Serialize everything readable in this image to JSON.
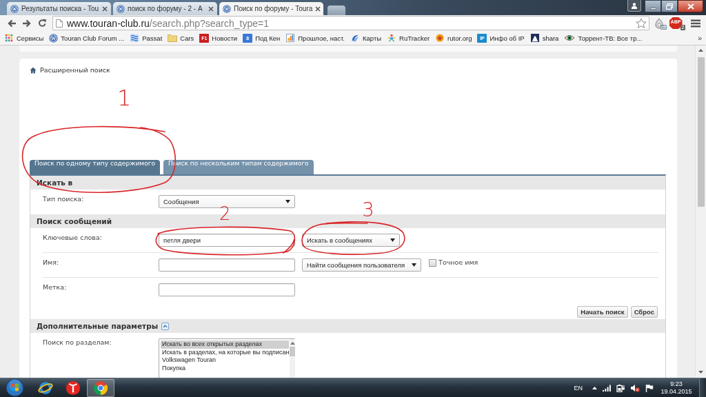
{
  "browser": {
    "tabs": [
      {
        "title": "Результаты поиска - Tou",
        "selected": false
      },
      {
        "title": "поиск по форуму - 2 - А",
        "selected": false
      },
      {
        "title": "Поиск по форуму - Toura",
        "selected": true
      }
    ],
    "address_bar": {
      "domain": "www.touran-club.ru",
      "path": "/search.php?search_type=1"
    },
    "extensions": [
      {
        "kind": "toggle",
        "label": "off"
      },
      {
        "kind": "blocker",
        "label": "ABP",
        "count": "2"
      }
    ],
    "bookmarks": [
      {
        "kind": "apps",
        "label": "Сервисы"
      },
      {
        "kind": "round-logo",
        "label": "Touran Club Forum ..."
      },
      {
        "kind": "stripes",
        "label": "Passat"
      },
      {
        "kind": "folder",
        "label": "Cars"
      },
      {
        "kind": "tile",
        "label": "Новости",
        "icon_text": "F1",
        "color": "#cc1f1f"
      },
      {
        "kind": "tile",
        "label": "Под Кен",
        "icon_text": "8",
        "color": "#3a78d8"
      },
      {
        "kind": "chart",
        "label": "Прошлое, наст."
      },
      {
        "kind": "swoosh",
        "label": "Карты"
      },
      {
        "kind": "figure",
        "label": "RuTracker"
      },
      {
        "kind": "star",
        "label": "rutor.org"
      },
      {
        "kind": "tile",
        "label": "Инфо об IP",
        "icon_text": "IP",
        "color": "#1a8ccc"
      },
      {
        "kind": "road",
        "label": "shara"
      },
      {
        "kind": "eye",
        "label": "Торрент-ТВ: Все тр..."
      }
    ],
    "bookmarks_overflow": "»"
  },
  "page": {
    "breadcrumb": "Расширенный поиск",
    "search_tabs": [
      {
        "label": "Поиск по одному типу содержимого",
        "selected": true
      },
      {
        "label": "Поиск по нескольким типам содержимого",
        "selected": false
      }
    ],
    "sections": [
      {
        "title": "Искать в",
        "collapsible": false,
        "rows": [
          {
            "label": "Тип поиска:",
            "fields": [
              {
                "kind": "select",
                "value": "Сообщения"
              }
            ]
          }
        ]
      },
      {
        "title": "Поиск сообщений",
        "collapsible": false,
        "rows": [
          {
            "label": "Ключевые слова:",
            "fields": [
              {
                "kind": "input",
                "value": "петля двери"
              },
              {
                "kind": "select",
                "value": "Искать в сообщениях"
              }
            ]
          },
          {
            "label": "Имя:",
            "fields": [
              {
                "kind": "input"
              },
              {
                "kind": "select",
                "value": "Найти сообщения пользователя"
              },
              {
                "kind": "checkbox",
                "label": "Точное имя",
                "checked": false
              }
            ]
          },
          {
            "label": "Метка:",
            "fields": [
              {
                "kind": "input"
              }
            ]
          }
        ],
        "buttons": [
          "Начать поиск",
          "Сброс"
        ]
      },
      {
        "title": "Дополнительные параметры",
        "collapsible": true,
        "rows": [
          {
            "label": "Поиск по разделам:",
            "fields": [
              {
                "kind": "listbox",
                "options": [
                  {
                    "label": "Искать во всех открытых разделах",
                    "selected": true
                  },
                  {
                    "label": "Искать в разделах, на которые вы подписан",
                    "selected": false
                  },
                  {
                    "label": "Volkswagen Touran",
                    "selected": false
                  },
                  {
                    "label": "Покупка",
                    "selected": false
                  }
                ]
              }
            ]
          }
        ]
      }
    ]
  },
  "annotations": [
    {
      "label": "1"
    },
    {
      "label": "2"
    },
    {
      "label": "3"
    }
  ],
  "taskbar": {
    "buttons": [
      {
        "kind": "start",
        "selected": false
      },
      {
        "kind": "ring",
        "selected": false
      },
      {
        "kind": "ball",
        "selected": false
      },
      {
        "kind": "segmented",
        "selected": true
      }
    ],
    "language": "EN",
    "time": "9:23",
    "date": "19.04.2015"
  }
}
